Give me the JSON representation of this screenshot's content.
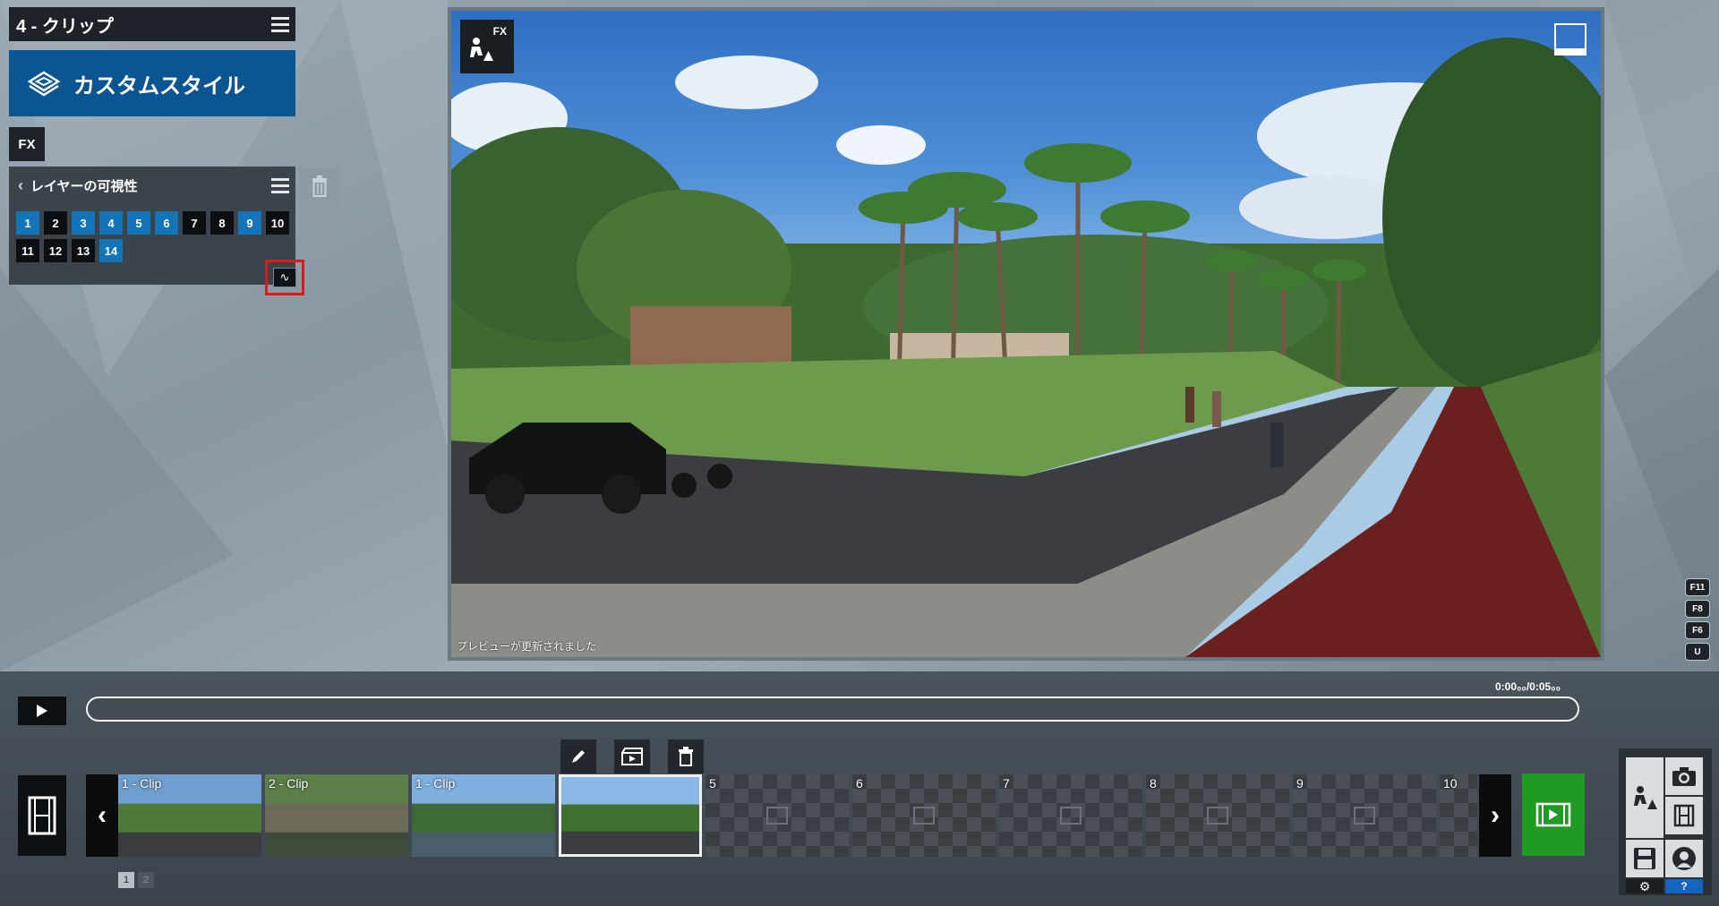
{
  "clip_header": {
    "title": "4 - クリップ"
  },
  "style_button": {
    "label": "カスタムスタイル"
  },
  "fx_tab": {
    "label": "FX"
  },
  "layer_panel": {
    "title": "レイヤーの可視性",
    "layers": [
      {
        "label": "1",
        "active": true
      },
      {
        "label": "2",
        "active": false
      },
      {
        "label": "3",
        "active": true
      },
      {
        "label": "4",
        "active": true
      },
      {
        "label": "5",
        "active": true
      },
      {
        "label": "6",
        "active": true
      },
      {
        "label": "7",
        "active": false
      },
      {
        "label": "8",
        "active": false
      },
      {
        "label": "9",
        "active": true
      },
      {
        "label": "10",
        "active": false
      },
      {
        "label": "11",
        "active": false
      },
      {
        "label": "12",
        "active": false
      },
      {
        "label": "13",
        "active": false
      },
      {
        "label": "14",
        "active": true
      }
    ]
  },
  "preview": {
    "fx_badge": "FX",
    "status": "プレビューが更新されました"
  },
  "key_buttons": [
    "F11",
    "F8",
    "F6",
    "U"
  ],
  "playback": {
    "timecode": "0:00₀₀/0:05₀₀"
  },
  "clips": [
    {
      "label": "1 - Clip",
      "type": "thumb",
      "selected": false
    },
    {
      "label": "2 - Clip",
      "type": "thumb",
      "selected": false
    },
    {
      "label": "1 - Clip",
      "type": "thumb",
      "selected": false
    },
    {
      "label": "",
      "type": "thumb",
      "selected": true
    },
    {
      "label": "5",
      "type": "empty",
      "selected": false
    },
    {
      "label": "6",
      "type": "empty",
      "selected": false
    },
    {
      "label": "7",
      "type": "empty",
      "selected": false
    },
    {
      "label": "8",
      "type": "empty",
      "selected": false
    },
    {
      "label": "9",
      "type": "empty",
      "selected": false
    },
    {
      "label": "10",
      "type": "empty",
      "selected": false
    }
  ],
  "pages": [
    {
      "label": "1",
      "active": true
    },
    {
      "label": "2",
      "active": false
    }
  ],
  "colors": {
    "accent_blue": "#1474b8",
    "style_blue": "#0b5593",
    "highlight_red": "#e01818",
    "add_green": "#1f9a23"
  }
}
